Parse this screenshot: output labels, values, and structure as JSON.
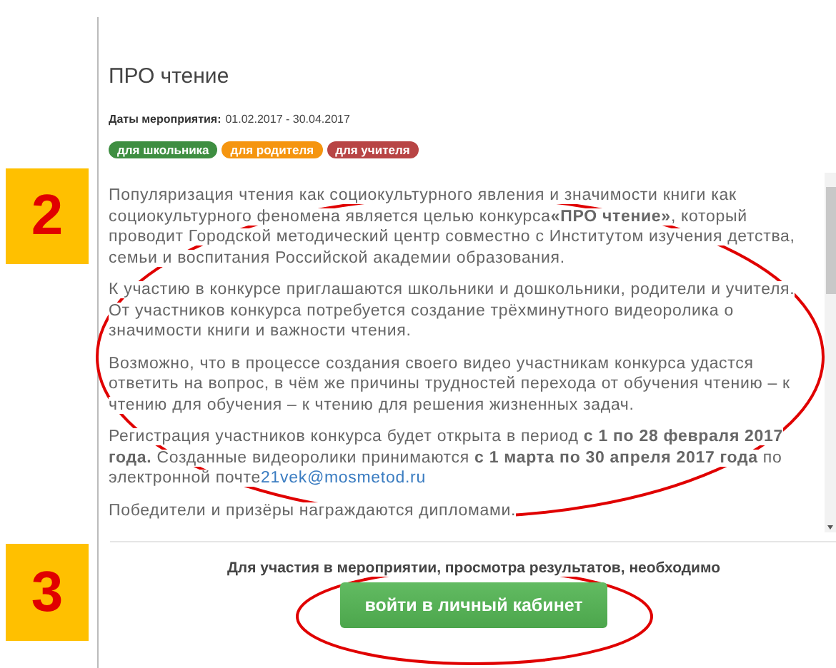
{
  "annotations": [
    {
      "label": "2"
    },
    {
      "label": "3"
    }
  ],
  "event": {
    "title": "ПРО чтение",
    "dates_label": "Даты мероприятия:",
    "dates_value": "01.02.2017 - 30.04.2017",
    "tags": [
      {
        "label": "для школьника",
        "color": "#3e8e41"
      },
      {
        "label": "для родителя",
        "color": "#f5950f"
      },
      {
        "label": "для учителя",
        "color": "#b84545"
      }
    ],
    "paragraphs": [
      {
        "text": "Популяризация чтения как социокультурного явления и значимости книги как социокультурного феномена является целью конкурса**«ПРО чтение»**, который проводит Городской методический центр совместно с Институтом изучения детства, семьи и воспитания Российской академии образования."
      },
      {
        "text": "К участию в конкурсе приглашаются школьники и дошкольники, родители и учителя. От участников конкурса потребуется создание трёхминутного видеоролика о значимости книги и важности чтения."
      },
      {
        "text": "Возможно, что в процессе создания своего видео участникам конкурса удастся ответить на вопрос, в чём же причины трудностей перехода от обучения чтению – к чтению для обучения – к чтению для решения жизненных задач."
      },
      {
        "text": "Регистрация участников конкурса будет открыта в период **с 1 по 28 февраля 2017 года.** Созданные видеоролики принимаются **с 1 марта по 30 апреля 2017 года** по электронной почте",
        "link": "21vek@mosmetod.ru"
      },
      {
        "text": "Победители и призёры награждаются дипломами."
      }
    ],
    "footer_text": "Для участия в мероприятии, просмотра результатов, необходимо",
    "login_button": "войти в личный кабинет"
  }
}
